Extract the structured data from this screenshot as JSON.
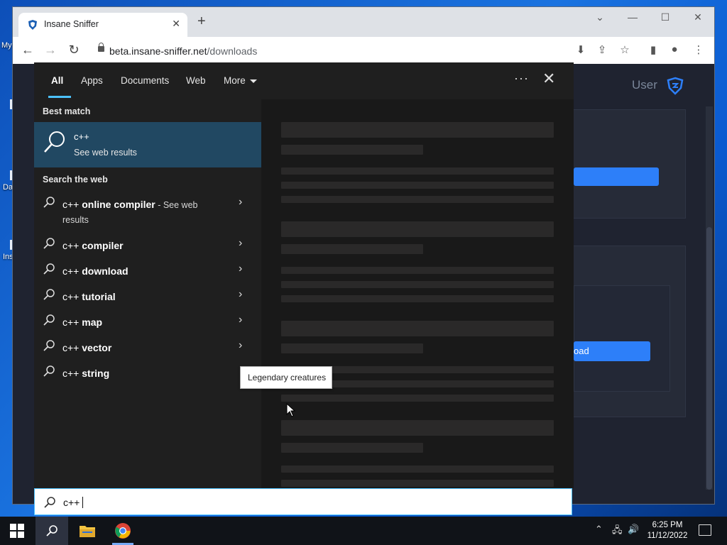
{
  "desktop": {
    "labels": [
      "My",
      "Da",
      "Ins"
    ]
  },
  "browser": {
    "tab_title": "Insane Sniffer",
    "url_host": "beta.insane-sniffer.net",
    "url_path": "/downloads",
    "page_user": "User",
    "download_button_fragment": "oad"
  },
  "search": {
    "tabs": [
      {
        "label": "All"
      },
      {
        "label": "Apps"
      },
      {
        "label": "Documents"
      },
      {
        "label": "Web"
      },
      {
        "label": "More"
      }
    ],
    "best_match_heading": "Best match",
    "best_match": {
      "title": "c++",
      "subtitle": "See web results"
    },
    "web_heading": "Search the web",
    "web_results": [
      {
        "prefix": "c++",
        "bold": " online compiler",
        "suffix": " - See web",
        "line2": "results",
        "chevron": true
      },
      {
        "prefix": "c++",
        "bold": " compiler",
        "suffix": "",
        "line2": "",
        "chevron": true
      },
      {
        "prefix": "c++",
        "bold": " download",
        "suffix": "",
        "line2": "",
        "chevron": true
      },
      {
        "prefix": "c++",
        "bold": " tutorial",
        "suffix": "",
        "line2": "",
        "chevron": true
      },
      {
        "prefix": "c++",
        "bold": " map",
        "suffix": "",
        "line2": "",
        "chevron": true
      },
      {
        "prefix": "c++",
        "bold": " vector",
        "suffix": "",
        "line2": "",
        "chevron": true
      },
      {
        "prefix": "c++",
        "bold": " string",
        "suffix": "",
        "line2": "",
        "chevron": false
      }
    ],
    "tooltip": "Legendary creatures",
    "query": "c++"
  },
  "taskbar": {
    "time": "6:25 PM",
    "date": "11/12/2022"
  },
  "colors": {
    "accent": "#4cc2ff",
    "best_match_bg": "#214862",
    "page_button": "#2d7ff9"
  }
}
